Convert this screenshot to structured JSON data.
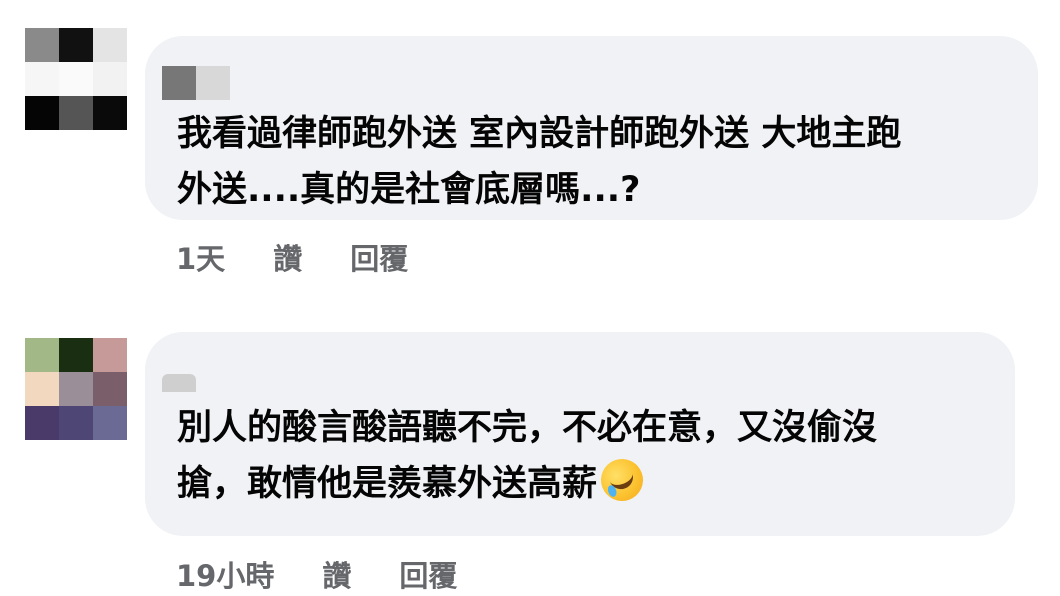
{
  "comments": [
    {
      "text_line1": "我看過律師跑外送 室內設計師跑外送 大地主跑",
      "text_line2": "外送....真的是社會底層嗎...?",
      "time": "1天",
      "like_label": "讚",
      "reply_label": "回覆",
      "avatar_pixels": [
        "#8a8a8a",
        "#111111",
        "#e4e4e4",
        "#f6f6f6",
        "#fafafa",
        "#f2f2f2",
        "#050505",
        "#555555",
        "#0a0a0a"
      ],
      "name_pixels": [
        "#777777",
        "#d8d8d8"
      ]
    },
    {
      "text_line1": "別人的酸言酸語聽不完，不必在意，又沒偷沒",
      "text_line2": "搶，敢情他是羨慕外送高薪",
      "emoji": "rolling-on-floor-laughing-emoji",
      "time": "19小時",
      "like_label": "讚",
      "reply_label": "回覆",
      "avatar_pixels": [
        "#a3b887",
        "#1a2e12",
        "#c79a9a",
        "#f2d8be",
        "#9a8f99",
        "#7a5f6a",
        "#4a3a6a",
        "#4e4776",
        "#6a6a94"
      ],
      "name_pixels": [
        "#cfcfcf"
      ]
    }
  ]
}
